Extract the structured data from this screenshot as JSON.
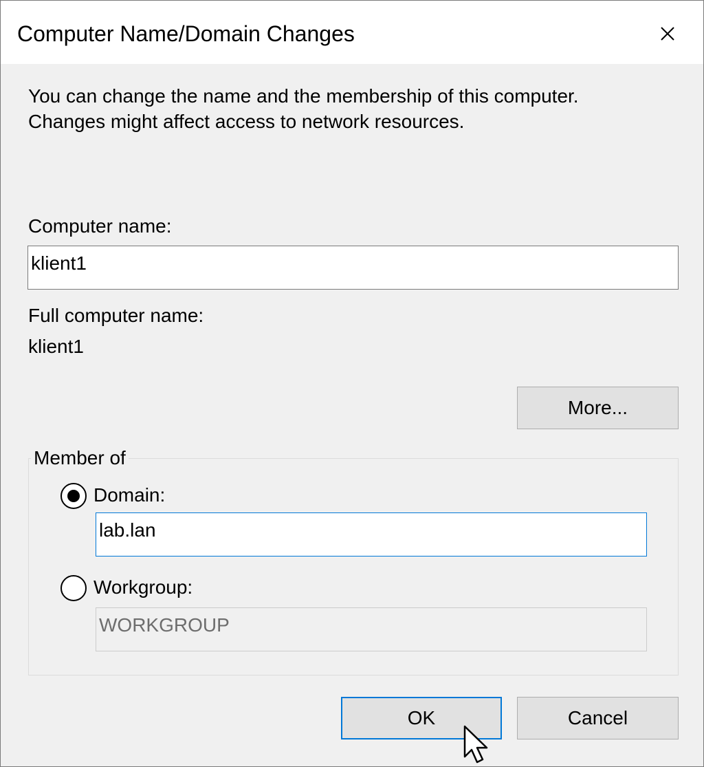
{
  "window": {
    "title": "Computer Name/Domain Changes",
    "close_icon": "close-icon"
  },
  "intro": {
    "line1": "You can change the name and the membership of this computer.",
    "line2": "Changes might affect access to network resources."
  },
  "computer_name": {
    "label": "Computer name:",
    "value": "klient1"
  },
  "full_computer_name": {
    "label": "Full computer name:",
    "value": "klient1"
  },
  "more_button": "More...",
  "member_of": {
    "legend": "Member of",
    "domain": {
      "label": "Domain:",
      "selected": true,
      "value": "lab.lan"
    },
    "workgroup": {
      "label": "Workgroup:",
      "selected": false,
      "value": "WORKGROUP",
      "disabled": true
    }
  },
  "buttons": {
    "ok": "OK",
    "cancel": "Cancel"
  },
  "colors": {
    "focus_border": "#0078d7",
    "dialog_bg": "#f0f0f0",
    "button_bg": "#e1e1e1"
  }
}
